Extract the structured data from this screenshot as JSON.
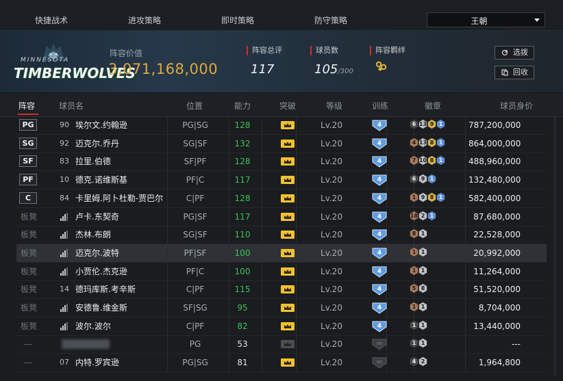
{
  "nav": {
    "tabs": [
      "快捷战术",
      "进攻策略",
      "即时策略",
      "防守策略"
    ],
    "team_select": "王朝"
  },
  "team": {
    "logo_top": "MINNESOTA",
    "logo_main": "TIMBERWOLVES",
    "value_label": "阵容价值",
    "value": "3,071,168,000",
    "rating_label": "阵容总评",
    "rating": "117",
    "players_label": "球员数",
    "players": "105",
    "players_max": "/300",
    "bond_label": "阵容羁绊"
  },
  "buttons": {
    "select": "选拨",
    "recycle": "回收"
  },
  "table": {
    "headers": [
      "阵容",
      "球员名",
      "位置",
      "能力",
      "突破",
      "等级",
      "训练",
      "徽章",
      "球员身价"
    ],
    "rows": [
      {
        "slot": "PG",
        "num": "90",
        "name": "埃尔文.约翰逊",
        "pos": "PG|SG",
        "ability": "128",
        "ability_color": "#3ec25a",
        "level": "Lv.20",
        "train": "4",
        "badges": [
          [
            "#4a4a4a",
            "6"
          ],
          [
            "#bfc2c6",
            "13"
          ],
          [
            "#d6b24a",
            "9"
          ],
          [
            "#5d8fd6",
            "1"
          ]
        ],
        "value": "787,200,000",
        "locked": false
      },
      {
        "slot": "SG",
        "num": "92",
        "name": "迈克尔.乔丹",
        "pos": "SG|SF",
        "ability": "132",
        "ability_color": "#3ec25a",
        "level": "Lv.20",
        "train": "4",
        "badges": [
          [
            "#a9785a",
            "4"
          ],
          [
            "#bfc2c6",
            "13"
          ],
          [
            "#d6b24a",
            "8"
          ],
          [
            "#5d8fd6",
            "1"
          ]
        ],
        "value": "864,000,000",
        "locked": false
      },
      {
        "slot": "SF",
        "num": "83",
        "name": "拉里.伯德",
        "pos": "SF|PF",
        "ability": "128",
        "ability_color": "#3ec25a",
        "level": "Lv.20",
        "train": "4",
        "badges": [
          [
            "#a9785a",
            "7"
          ],
          [
            "#bfc2c6",
            "10"
          ],
          [
            "#d6b24a",
            "8"
          ],
          [
            "#5d8fd6",
            "1"
          ]
        ],
        "value": "488,960,000",
        "locked": false
      },
      {
        "slot": "PF",
        "num": "10",
        "name": "德克.诺维斯基",
        "pos": "PF|C",
        "ability": "117",
        "ability_color": "#3ec25a",
        "level": "Lv.20",
        "train": "4",
        "badges": [
          [
            "#4a4a4a",
            "6"
          ],
          [
            "#bfc2c6",
            "9"
          ],
          [
            "#5d8fd6",
            "1"
          ]
        ],
        "value": "132,480,000",
        "locked": false
      },
      {
        "slot": "C",
        "num": "84",
        "name": "卡里姆.阿卜杜勒-贾巴尔",
        "pos": "C|PF",
        "ability": "128",
        "ability_color": "#3ec25a",
        "level": "Lv.20",
        "train": "4",
        "badges": [
          [
            "#a9785a",
            "1"
          ],
          [
            "#bfc2c6",
            "9"
          ],
          [
            "#d6b24a",
            "8"
          ],
          [
            "#5d8fd6",
            "1"
          ]
        ],
        "value": "582,400,000",
        "locked": false
      },
      {
        "slot": "板凳",
        "num": "",
        "name": "卢卡.东契奇",
        "pos": "PG|SF",
        "ability": "117",
        "ability_color": "#3ec25a",
        "level": "Lv.20",
        "train": "4",
        "badges": [
          [
            "#a9785a",
            "18"
          ],
          [
            "#bfc2c6",
            "2"
          ],
          [
            "#5d8fd6",
            "1"
          ]
        ],
        "value": "87,680,000",
        "locked": false
      },
      {
        "slot": "板凳",
        "num": "",
        "name": "杰林.布朗",
        "pos": "SG|SF",
        "ability": "110",
        "ability_color": "#3ec25a",
        "level": "Lv.20",
        "train": "4",
        "badges": [
          [
            "#a9785a",
            "8"
          ],
          [
            "#bfc2c6",
            "1"
          ]
        ],
        "value": "22,528,000",
        "locked": false
      },
      {
        "slot": "板凳",
        "num": "",
        "name": "迈克尔.波特",
        "pos": "PF|SF",
        "ability": "100",
        "ability_color": "#3ec25a",
        "level": "Lv.20",
        "train": "4",
        "badges": [
          [
            "#a9785a",
            "1"
          ],
          [
            "#bfc2c6",
            "1"
          ]
        ],
        "value": "20,992,000",
        "locked": false
      },
      {
        "slot": "板凳",
        "num": "",
        "name": "小贾伦.杰克逊",
        "pos": "PF|C",
        "ability": "100",
        "ability_color": "#3ec25a",
        "level": "Lv.20",
        "train": "4",
        "badges": [
          [
            "#a9785a",
            "1"
          ],
          [
            "#bfc2c6",
            "1"
          ]
        ],
        "value": "11,264,000",
        "locked": false
      },
      {
        "slot": "板凳",
        "num": "14",
        "name": "德玛库斯.考辛斯",
        "pos": "C|PF",
        "ability": "115",
        "ability_color": "#3ec25a",
        "level": "Lv.20",
        "train": "4",
        "badges": [
          [
            "#a9785a",
            "5"
          ],
          [
            "#bfc2c6",
            "8"
          ]
        ],
        "value": "51,520,000",
        "locked": false
      },
      {
        "slot": "板凳",
        "num": "",
        "name": "安德鲁.维金斯",
        "pos": "SF|SG",
        "ability": "95",
        "ability_color": "#3ec25a",
        "level": "Lv.20",
        "train": "4",
        "badges": [
          [
            "#a9785a",
            "1"
          ],
          [
            "#bfc2c6",
            "1"
          ]
        ],
        "value": "8,704,000",
        "locked": false
      },
      {
        "slot": "板凳",
        "num": "",
        "name": "波尔.波尔",
        "pos": "C|PF",
        "ability": "82",
        "ability_color": "#3ec25a",
        "level": "Lv.20",
        "train": "4",
        "badges": [
          [
            "#4a4a4a",
            "1"
          ],
          [
            "#bfc2c6",
            "1"
          ]
        ],
        "value": "13,440,000",
        "locked": false
      },
      {
        "slot": "---",
        "num": "",
        "name": "",
        "pos": "PG",
        "ability": "53",
        "ability_color": "#e4e6e8",
        "level": "Lv.20",
        "train": "",
        "badges": [
          [
            "#4a4a4a",
            "1"
          ],
          [
            "#bfc2c6",
            "1"
          ]
        ],
        "value": "---",
        "locked": true
      },
      {
        "slot": "---",
        "num": "07",
        "name": "内特.罗宾逊",
        "pos": "PG|SG",
        "ability": "81",
        "ability_color": "#e4e6e8",
        "level": "Lv.20",
        "train": "",
        "badges": [
          [
            "#4a4a4a",
            "4"
          ],
          [
            "#bfc2c6",
            "2"
          ]
        ],
        "value": "1,964,800",
        "locked": true
      }
    ]
  },
  "colors": {
    "accent_red": "#d22c2c",
    "gold": "#e2a93a",
    "ability_green": "#3ec25a",
    "train_blue": "#5f9be0"
  }
}
